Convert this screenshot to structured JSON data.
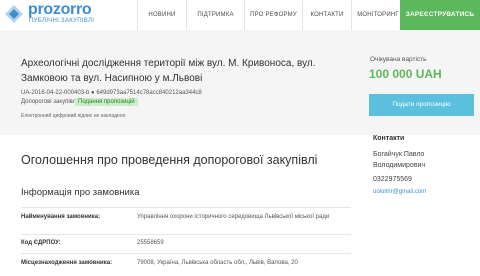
{
  "header": {
    "logo_text": "prozorro",
    "logo_sub": "ПУБЛІЧНІ ЗАКУПІВЛІ",
    "nav": [
      "НОВИНИ",
      "ПІДТРИМКА",
      "ПРО РЕФОРМУ",
      "КОНТАКТИ",
      "МОНІТОРИНГ"
    ],
    "register_label": "ЗАРЕЄСТРУВАТИСЬ"
  },
  "tender": {
    "title": "Археологічні дослідження території між вул. М. Кривоноса, вул. Замковою та вул. Насипною у м.Львові",
    "id": "UA-2016-04-22-000403-b  ●  649d973aa7514c78acc840212aa344c8",
    "type": "Допороговi закупівлі",
    "status": "Подання пропозицій",
    "signature_note": "Електронний цифровий підпис не накладено",
    "budget_label": "Очікувана вартість",
    "budget_value": "100 000 UAH",
    "submit_label": "Подати пропозицію"
  },
  "contacts": {
    "title": "Контакти",
    "name": "Богайчук Павло Володимирович",
    "phone": "0322975569",
    "email": "uoiolmr@gmail.com"
  },
  "main": {
    "announce_title": "Оголошення про проведення допорогової закупівлі",
    "customer_heading": "Інформація про замовника",
    "fields": [
      {
        "label": "Найменування замовника:",
        "value": "Управління охорони історичного середовища Львівської міської ради"
      },
      {
        "label": "Код ЄДРПОУ:",
        "value": "25558659"
      },
      {
        "label": "Місцезнаходження замовника:",
        "value": "79008, Україна, Львівська область обл., Львів, Валова, 20"
      }
    ]
  },
  "colors": {
    "brand": "#3b8fd0",
    "register": "#5cb85c",
    "budget": "#5cb85c",
    "submit": "#5bc0de",
    "status_badge": "#c9eec9"
  }
}
